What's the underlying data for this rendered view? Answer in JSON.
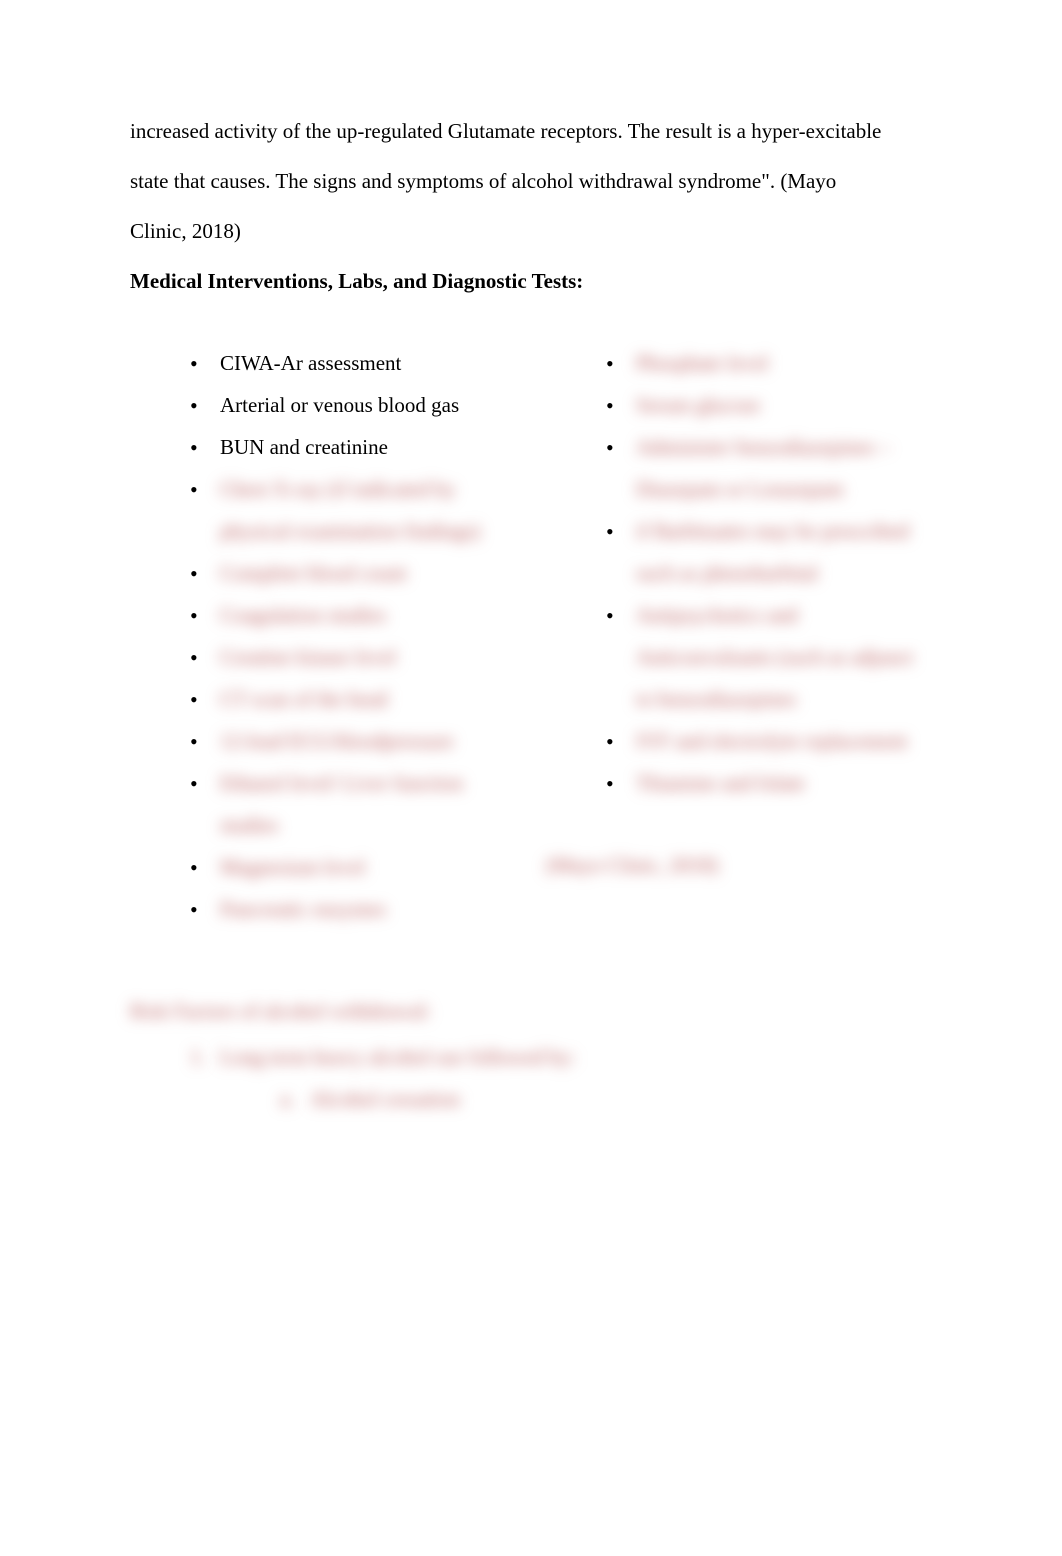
{
  "intro": {
    "line1": "increased activity of the up-regulated Glutamate receptors. The result is a hyper-excitable",
    "line2": "state that causes. The signs and symptoms of alcohol withdrawal syndrome\". (Mayo",
    "line3": "Clinic, 2018)"
  },
  "section_heading": "Medical Interventions, Labs, and Diagnostic Tests:",
  "left_items": [
    {
      "text": "CIWA-Ar assessment",
      "clear": true
    },
    {
      "text": "Arterial or venous blood gas",
      "clear": true
    },
    {
      "text": "BUN and creatinine",
      "clear": true
    },
    {
      "text": "Chest X-ray (if indicated by",
      "clear": false
    },
    {
      "text_cont": "physical examination findings)",
      "clear": false,
      "continuation": true
    },
    {
      "text": "Complete blood count",
      "clear": false
    },
    {
      "text": "Coagulation studies",
      "clear": false
    },
    {
      "text": "Creatine kinase level",
      "clear": false
    },
    {
      "text": "CT scan of the head",
      "clear": false
    },
    {
      "text": "12-lead ECG/bloodpressure",
      "clear": false
    },
    {
      "text": "Ethanol level/ Liver function",
      "clear": false
    },
    {
      "text_cont": "studies",
      "clear": false,
      "continuation": true
    },
    {
      "text": "Magnesium level",
      "clear": false
    },
    {
      "text": "Pancreatic enzymes",
      "clear": false
    }
  ],
  "right_items": [
    {
      "text": "Phosphate level",
      "clear": false
    },
    {
      "text": "Serum glucose",
      "clear": false
    },
    {
      "text": "Administer benzodiazepines –",
      "clear": false
    },
    {
      "text_cont": "Diazepam or Lorazepam",
      "clear": false,
      "continuation": true
    },
    {
      "text": "if Barbituates may be prescribed",
      "clear": false
    },
    {
      "text_cont": "such as phenobarbital",
      "clear": false,
      "continuation": true
    },
    {
      "text": "Antipsychotics and",
      "clear": false
    },
    {
      "text_cont": "Anticonvulsants (such as adjunct",
      "clear": false,
      "continuation": true
    },
    {
      "text_cont": "to benzodiazepines",
      "clear": false,
      "continuation": true
    },
    {
      "text": "IVF and electrolyte replacement",
      "clear": false
    },
    {
      "text": "Thiamine and folate",
      "clear": false
    }
  ],
  "citation": "(Mayo Clinic, 2018)",
  "risk": {
    "heading": "Risk Factors of alcohol withdrawal:",
    "item1": "Long term heavy alcohol use followed by:",
    "sub_a_marker": "a.",
    "sub_a": "Alcohol cessation"
  }
}
